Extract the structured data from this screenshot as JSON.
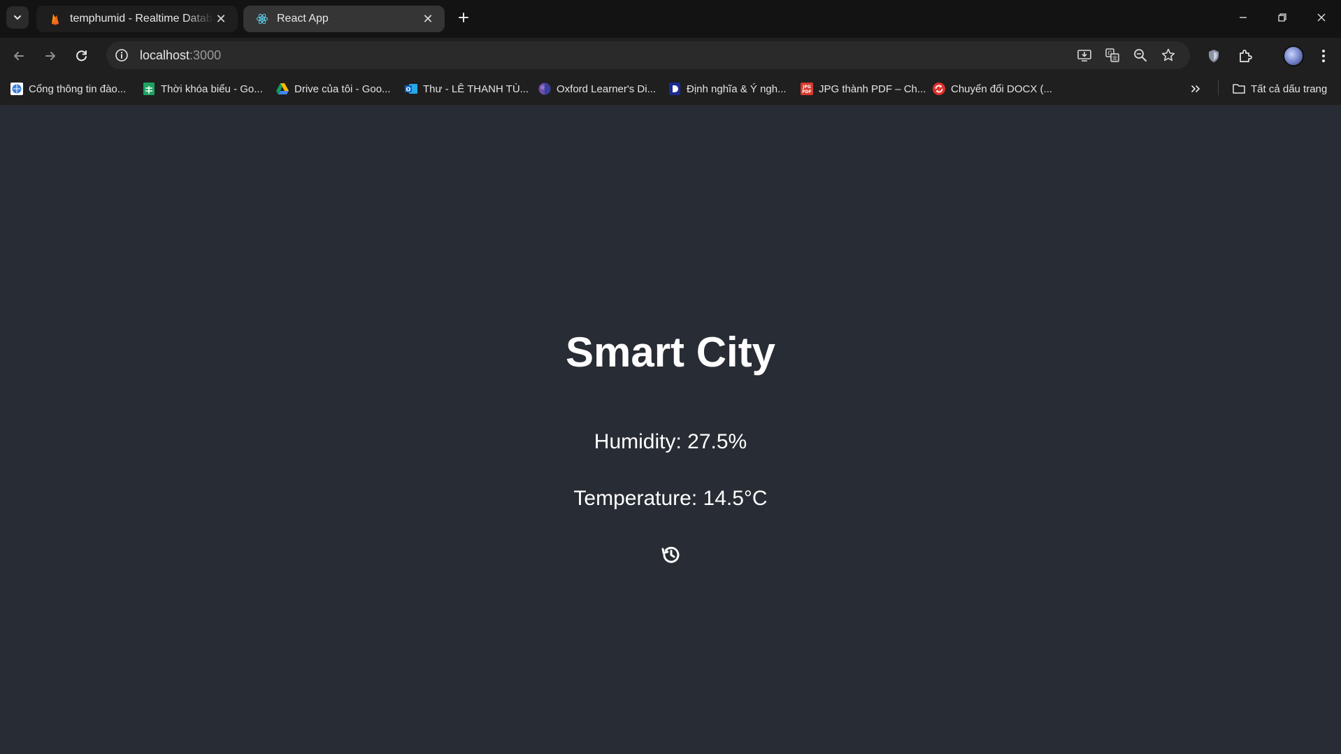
{
  "browser": {
    "tabs": [
      {
        "title": "temphumid - Realtime Database",
        "icon": "firebase-icon",
        "active": false
      },
      {
        "title": "React App",
        "icon": "react-icon",
        "active": true
      }
    ],
    "url": {
      "host": "localhost",
      "port": ":3000"
    },
    "bookmarks": [
      {
        "label": "Cổng thông tin đào...",
        "icon": "portal-icon"
      },
      {
        "label": "Thời khóa biểu - Go...",
        "icon": "sheets-icon"
      },
      {
        "label": "Drive của tôi - Goo...",
        "icon": "drive-icon"
      },
      {
        "label": "Thư - LÊ THANH TÙ...",
        "icon": "outlook-icon"
      },
      {
        "label": "Oxford Learner's Di...",
        "icon": "oxford-icon"
      },
      {
        "label": "Định nghĩa & Ý ngh...",
        "icon": "dictionary-icon"
      },
      {
        "label": "JPG thành PDF – Ch...",
        "icon": "jpg-pdf-icon"
      },
      {
        "label": "Chuyển đổi DOCX (...",
        "icon": "convert-icon"
      }
    ],
    "all_bookmarks_label": "Tất cả dấu trang"
  },
  "app": {
    "title": "Smart City",
    "humidity_text": "Humidity: 27.5%",
    "temperature_text": "Temperature: 14.5°C",
    "history_icon": "history-icon"
  },
  "colors": {
    "page_background": "#282c34",
    "chrome_background": "#1f1f1f",
    "text": "#ffffff"
  }
}
